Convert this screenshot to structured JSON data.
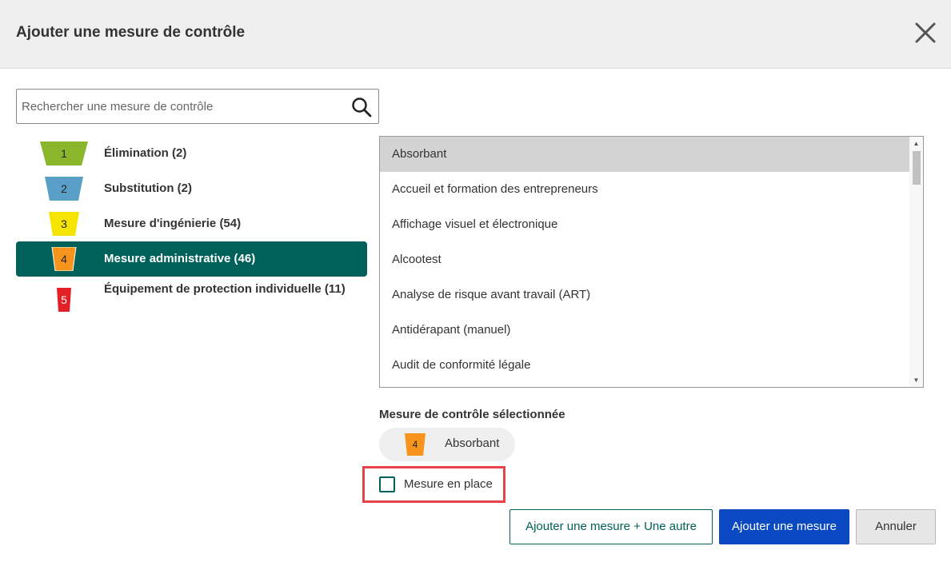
{
  "dialog": {
    "title": "Ajouter une mesure de contrôle"
  },
  "search": {
    "placeholder": "Rechercher une mesure de contrôle",
    "value": ""
  },
  "categories": [
    {
      "number": "1",
      "label": "Élimination (2)",
      "color": "#8ab62b"
    },
    {
      "number": "2",
      "label": "Substitution (2)",
      "color": "#5a9fc8"
    },
    {
      "number": "3",
      "label": "Mesure d'ingénierie (54)",
      "color": "#f5e400"
    },
    {
      "number": "4",
      "label": "Mesure administrative (46)",
      "color": "#f7941d",
      "active": true
    },
    {
      "number": "5",
      "label": "Équipement de protection individuelle (11)",
      "color": "#e32026"
    }
  ],
  "colors": {
    "active_category_bg": "#00605a",
    "primary_button": "#0a49c1",
    "highlight_border": "#e8424a"
  },
  "measures": [
    {
      "label": "Absorbant",
      "selected": true
    },
    {
      "label": "Accueil et formation des entrepreneurs"
    },
    {
      "label": "Affichage visuel et électronique"
    },
    {
      "label": "Alcootest"
    },
    {
      "label": "Analyse de risque avant travail (ART)"
    },
    {
      "label": "Antidérapant (manuel)"
    },
    {
      "label": "Audit de conformité légale"
    }
  ],
  "selection": {
    "title": "Mesure de contrôle sélectionnée",
    "badge_number": "4",
    "badge_color": "#f7941d",
    "label": "Absorbant"
  },
  "in_place": {
    "label": "Mesure en place",
    "checked": false
  },
  "buttons": {
    "add_another": "Ajouter une mesure + Une autre",
    "add": "Ajouter une mesure",
    "cancel": "Annuler"
  }
}
